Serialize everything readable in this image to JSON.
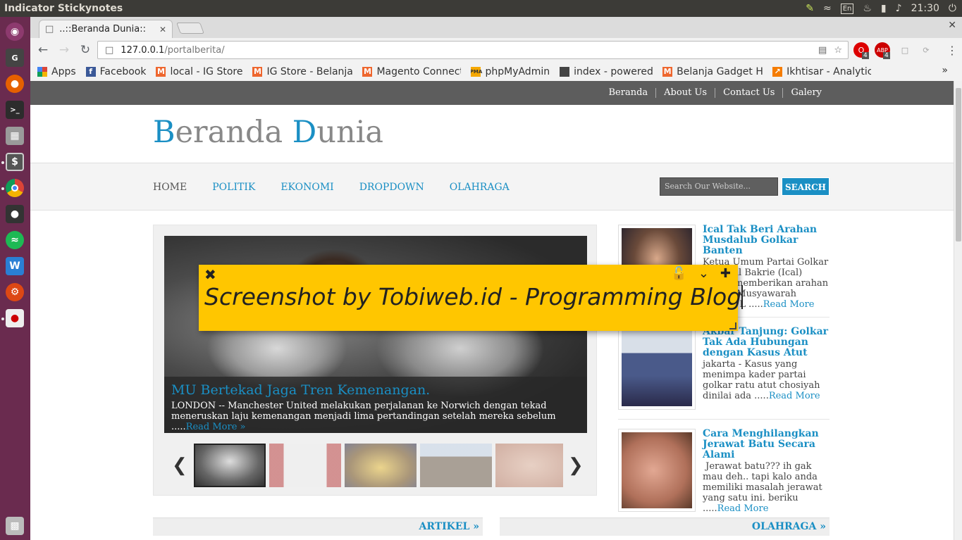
{
  "topbar": {
    "app_name": "Indicator Stickynotes",
    "lang": "En",
    "clock": "21:30"
  },
  "browser": {
    "tab_title": "..::Beranda Dunia::",
    "url_host": "127.0.0.1",
    "url_path": "/portalberita/",
    "ext_badge_1": "4",
    "ext_badge_2": "4"
  },
  "bookmarks": [
    {
      "label": "Apps"
    },
    {
      "label": "Facebook"
    },
    {
      "label": "local - IG Store"
    },
    {
      "label": "IG Store - Belanja"
    },
    {
      "label": "Magento Connect"
    },
    {
      "label": "phpMyAdmin"
    },
    {
      "label": "index - powered by"
    },
    {
      "label": "Belanja Gadget H"
    },
    {
      "label": "Ikhtisar - Analytic"
    }
  ],
  "site": {
    "topnav": [
      "Beranda",
      "About Us",
      "Contact Us",
      "Galery"
    ],
    "logo_b": "B",
    "logo_1": "eranda ",
    "logo_d": "D",
    "logo_2": "unia",
    "menu": [
      "HOME",
      "POLITIK",
      "EKONOMI",
      "DROPDOWN",
      "OLAHRAGA"
    ],
    "search_placeholder": "Search Our Website...",
    "search_button": "SEARCH",
    "slider": {
      "title": "MU Bertekad Jaga Tren Kemenangan.",
      "desc": "LONDON -- Manchester United melakukan perjalanan ke Norwich dengan tekad meneruskan laju kemenangan menjadi lima pertandingan setelah mereka sebelum .....",
      "read_more": "Read More »"
    },
    "posts": [
      {
        "title": "Ical Tak Beri Arahan Musdalub Golkar Banten",
        "desc": "Ketua Umum Partai Golkar Aburizal Bakrie (Ical) belum memberikan arahan terkait Musyawarah Daerah L .....",
        "more": "Read More"
      },
      {
        "title": "Akbar Tanjung: Golkar Tak Ada Hubungan dengan Kasus Atut",
        "desc": "jakarta - Kasus yang menimpa kader partai golkar ratu atut chosiyah dinilai ada .....",
        "more": "Read More"
      },
      {
        "title": "Cara Menghilangkan Jerawat Batu Secara Alami",
        "desc": " Jerawat batu??? ih gak mau deh.. tapi kalo anda memiliki masalah jerawat yang satu ini. beriku .....",
        "more": "Read More"
      }
    ],
    "section_artikel": "ARTIKEL »",
    "section_olahraga": "OLAHRAGA »"
  },
  "sticky": {
    "note": "Screenshot by Tobiweb.id - Programming Blog"
  },
  "colors": {
    "accent": "#1a8fc4",
    "sticky": "#ffc600",
    "launcher": "#6a2b4f"
  }
}
